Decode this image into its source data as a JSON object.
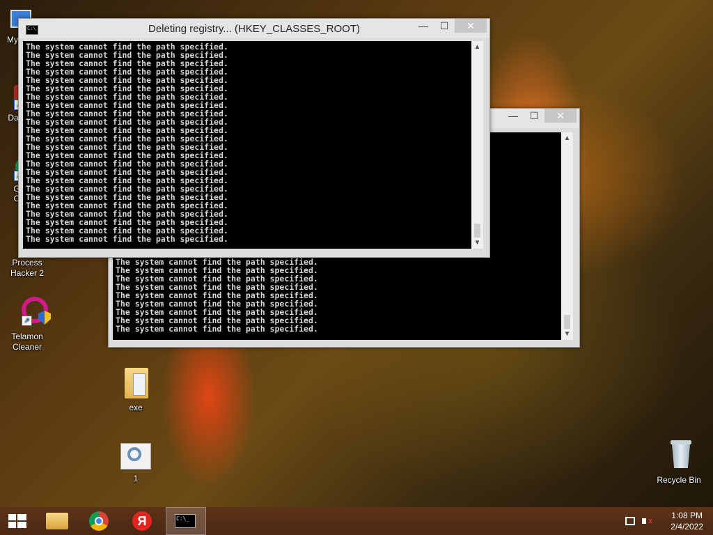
{
  "desktop": {
    "icons": [
      {
        "label": "My C"
      },
      {
        "label": "Data"
      },
      {
        "label": "G\nC"
      },
      {
        "label": "Process Hacker 2"
      },
      {
        "label": "Telamon Cleaner"
      },
      {
        "label": "exe"
      },
      {
        "label": "1"
      },
      {
        "label": "Recycle Bin"
      }
    ]
  },
  "window_front": {
    "title": "Deleting registry... (HKEY_CLASSES_ROOT)",
    "lines": "The system cannot find the path specified.\nThe system cannot find the path specified.\nThe system cannot find the path specified.\nThe system cannot find the path specified.\nThe system cannot find the path specified.\nThe system cannot find the path specified.\nThe system cannot find the path specified.\nThe system cannot find the path specified.\nThe system cannot find the path specified.\nThe system cannot find the path specified.\nThe system cannot find the path specified.\nThe system cannot find the path specified.\nThe system cannot find the path specified.\nThe system cannot find the path specified.\nThe system cannot find the path specified.\nThe system cannot find the path specified.\nThe system cannot find the path specified.\nThe system cannot find the path specified.\nThe system cannot find the path specified.\nThe system cannot find the path specified.\nThe system cannot find the path specified.\nThe system cannot find the path specified.\nThe system cannot find the path specified.\nThe system cannot find the path specified."
  },
  "window_back": {
    "lines": "The system cannot find the path specified.\nThe system cannot find the path specified.\nThe system cannot find the path specified.\nThe system cannot find the path specified.\nThe system cannot find the path specified.\nThe system cannot find the path specified.\nThe system cannot find the path specified.\nThe system cannot find the path specified.\nThe system cannot find the path specified."
  },
  "titlebar_buttons": {
    "minimize": "—",
    "maximize": "☐",
    "close": "✕"
  },
  "scroll_arrows": {
    "up": "▲",
    "down": "▼"
  },
  "taskbar": {
    "start_icon": "windows-logo-icon",
    "pinned": [
      "file-explorer-icon",
      "chrome-icon",
      "yandex-browser-icon",
      "command-prompt-icon"
    ],
    "yandex_glyph": "Я",
    "clock_time": "1:08 PM",
    "clock_date": "2/4/2022"
  }
}
